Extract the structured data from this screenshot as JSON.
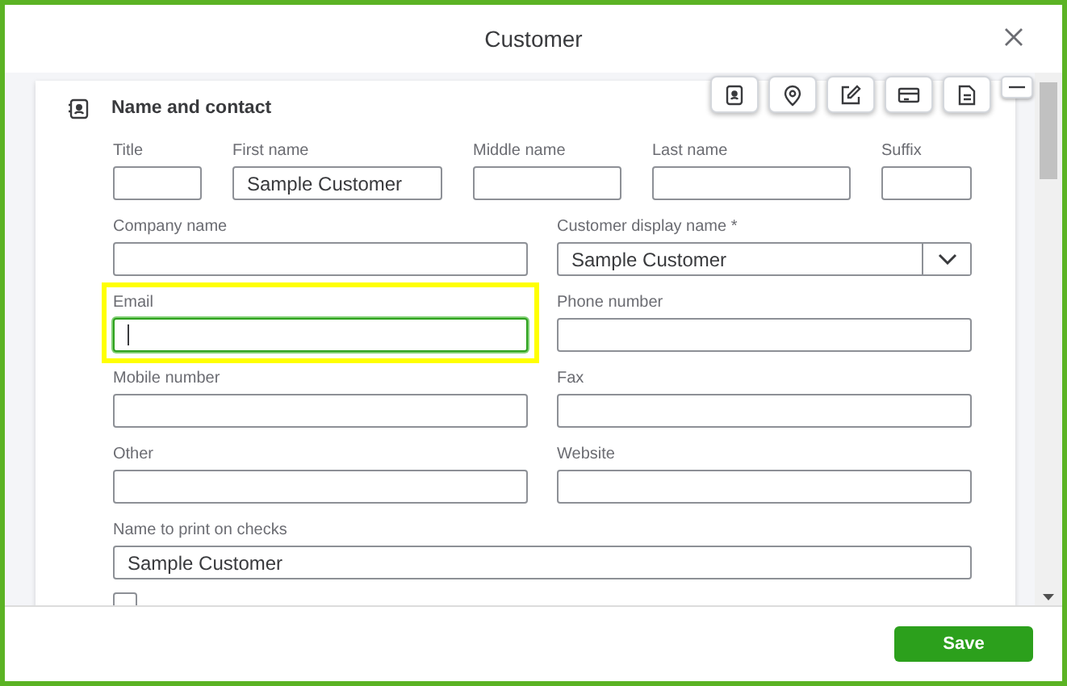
{
  "window": {
    "title": "Customer"
  },
  "section": {
    "title": "Name and contact"
  },
  "rows": [
    {
      "fields": [
        {
          "label": "Title",
          "kind": "text",
          "focused": false,
          "highlighted": false
        },
        {
          "label": "First name",
          "kind": "text",
          "value": "Sample Customer",
          "focused": false,
          "highlighted": false
        },
        {
          "label": "Middle name",
          "kind": "text",
          "focused": false,
          "highlighted": false
        },
        {
          "label": "Last name",
          "kind": "text",
          "focused": false,
          "highlighted": false
        },
        {
          "label": "Suffix",
          "kind": "text",
          "focused": false,
          "highlighted": false
        }
      ]
    },
    {
      "fields": [
        {
          "label": "Company name",
          "kind": "text",
          "focused": false,
          "highlighted": false
        },
        {
          "label": "Customer display name *",
          "kind": "dropdown",
          "value": "Sample Customer",
          "focused": false,
          "highlighted": false
        }
      ]
    },
    {
      "fields": [
        {
          "label": "Email",
          "kind": "text",
          "focused": true,
          "highlighted": true
        },
        {
          "label": "Phone number",
          "kind": "text",
          "focused": false,
          "highlighted": false
        }
      ]
    },
    {
      "fields": [
        {
          "label": "Mobile number",
          "kind": "text",
          "focused": false,
          "highlighted": false
        },
        {
          "label": "Fax",
          "kind": "text",
          "focused": false,
          "highlighted": false
        }
      ]
    },
    {
      "fields": [
        {
          "label": "Other",
          "kind": "text",
          "focused": false,
          "highlighted": false
        },
        {
          "label": "Website",
          "kind": "text",
          "focused": false,
          "highlighted": false
        }
      ]
    },
    {
      "fields": [
        {
          "label": "Name to print on checks",
          "kind": "text",
          "value": "Sample Customer",
          "focused": false,
          "highlighted": false
        }
      ]
    }
  ],
  "bottom_checkbox": {
    "checked": false
  },
  "save_button": "Save"
}
